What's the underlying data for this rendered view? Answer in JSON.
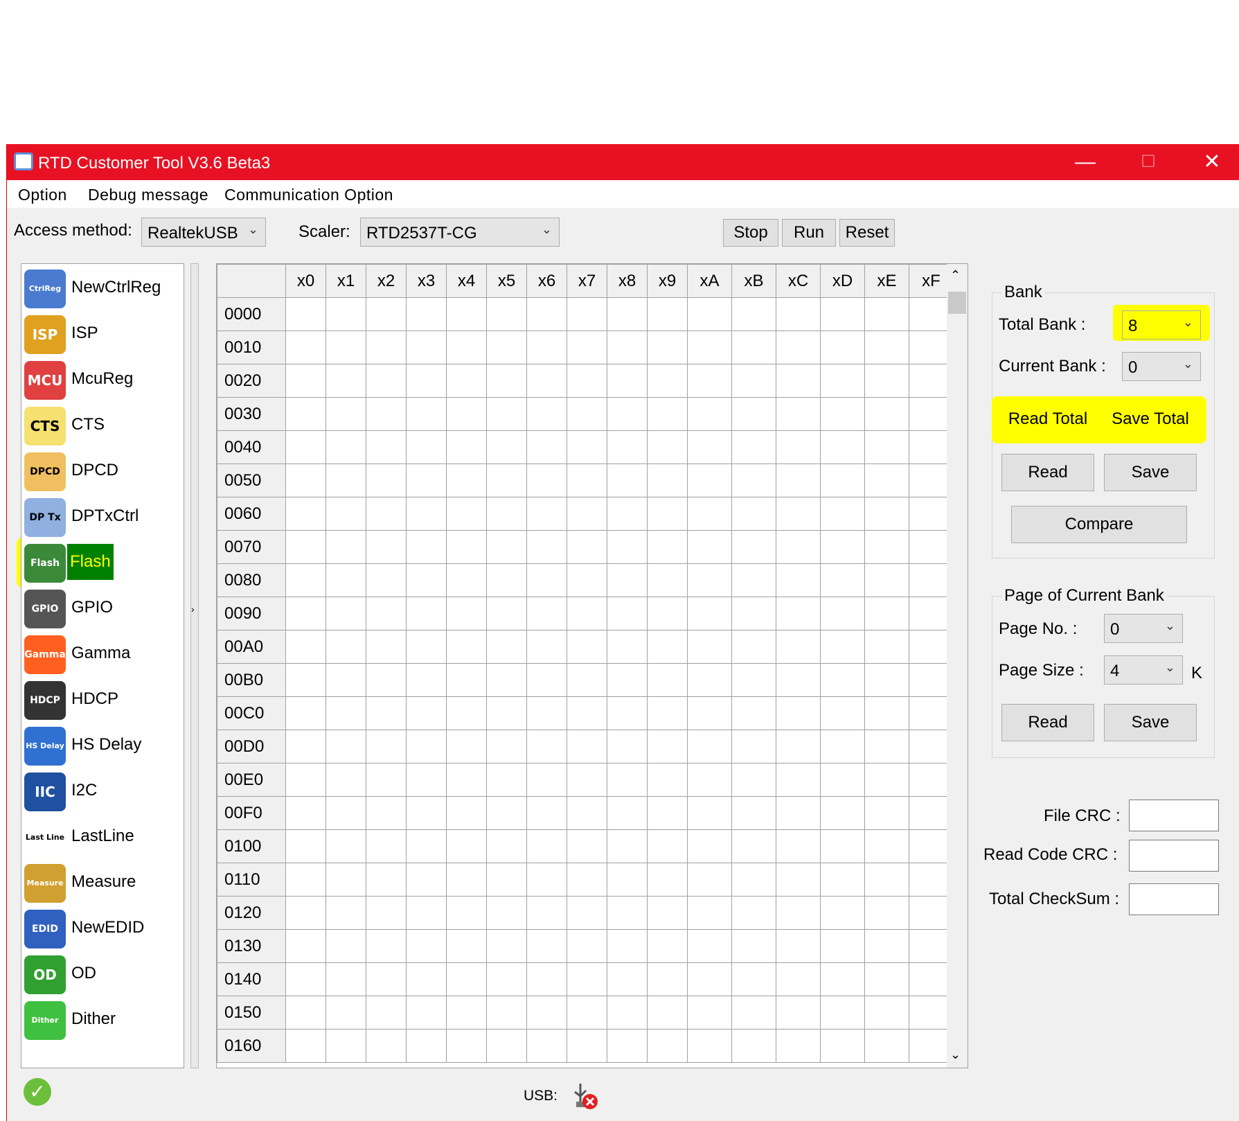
{
  "window": {
    "title": "RTD Customer Tool V3.6 Beta3",
    "minimize": "—",
    "maximize": "☐",
    "close": "✕"
  },
  "menu": [
    "Option",
    "Debug message",
    "Communication Option"
  ],
  "toolbar": {
    "access_label": "Access method:",
    "access_value": "RealtekUSB",
    "scaler_label": "Scaler:",
    "scaler_value": "RTD2537T-CG",
    "stop": "Stop",
    "run": "Run",
    "reset": "Reset"
  },
  "sidebar": {
    "items": [
      {
        "label": "NewCtrlReg",
        "icon": "CtrlReg",
        "color": "#4a7bd0"
      },
      {
        "label": "ISP",
        "icon": "ISP",
        "color": "#e0a020"
      },
      {
        "label": "McuReg",
        "icon": "MCU",
        "color": "#e04040"
      },
      {
        "label": "CTS",
        "icon": "CTS",
        "color": "#f5e070"
      },
      {
        "label": "DPCD",
        "icon": "DPCD",
        "color": "#f0c060"
      },
      {
        "label": "DPTxCtrl",
        "icon": "DP Tx",
        "color": "#8fb0e0"
      },
      {
        "label": "Flash",
        "icon": "Flash",
        "color": "#3a8a3a"
      },
      {
        "label": "GPIO",
        "icon": "GPIO",
        "color": "#555555"
      },
      {
        "label": "Gamma",
        "icon": "Gamma",
        "color": "#ff6020"
      },
      {
        "label": "HDCP",
        "icon": "HDCP",
        "color": "#333333"
      },
      {
        "label": "HS Delay",
        "icon": "HS Delay",
        "color": "#3070d0"
      },
      {
        "label": "I2C",
        "icon": "IIC",
        "color": "#2050a0"
      },
      {
        "label": "LastLine",
        "icon": "Last Line",
        "color": "#ffffff"
      },
      {
        "label": "Measure",
        "icon": "Measure",
        "color": "#d0a030"
      },
      {
        "label": "NewEDID",
        "icon": "EDID",
        "color": "#3060c0"
      },
      {
        "label": "OD",
        "icon": "OD",
        "color": "#30a030"
      },
      {
        "label": "Dither",
        "icon": "Dither",
        "color": "#40c040"
      }
    ],
    "selected": "Flash"
  },
  "grid": {
    "columns": [
      "x0",
      "x1",
      "x2",
      "x3",
      "x4",
      "x5",
      "x6",
      "x7",
      "x8",
      "x9",
      "xA",
      "xB",
      "xC",
      "xD",
      "xE",
      "xF"
    ],
    "rows": [
      "0000",
      "0010",
      "0020",
      "0030",
      "0040",
      "0050",
      "0060",
      "0070",
      "0080",
      "0090",
      "00A0",
      "00B0",
      "00C0",
      "00D0",
      "00E0",
      "00F0",
      "0100",
      "0110",
      "0120",
      "0130",
      "0140",
      "0150",
      "0160"
    ]
  },
  "bank": {
    "title": "Bank",
    "total_label": "Total Bank :",
    "total_value": "8",
    "current_label": "Current Bank :",
    "current_value": "0",
    "read_total": "Read Total",
    "save_total": "Save Total",
    "read": "Read",
    "save": "Save",
    "compare": "Compare"
  },
  "page": {
    "title": "Page of Current Bank",
    "page_no_label": "Page No. :",
    "page_no_value": "0",
    "page_size_label": "Page Size :",
    "page_size_value": "4",
    "unit": "K",
    "read": "Read",
    "save": "Save"
  },
  "crc": {
    "file": "File CRC :",
    "read_code": "Read Code CRC :",
    "checksum": "Total CheckSum :"
  },
  "status": {
    "usb_label": "USB:"
  },
  "colors": {
    "titlebar": "#e81123",
    "highlight": "#ffff00",
    "selected_item": "#008000"
  }
}
